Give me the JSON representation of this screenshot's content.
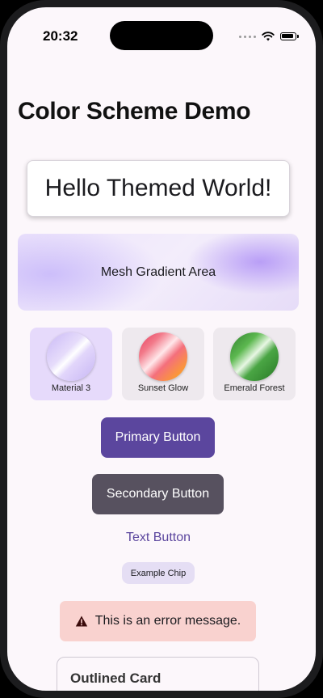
{
  "status_bar": {
    "time": "20:32"
  },
  "page": {
    "title": "Color Scheme Demo"
  },
  "hello_card": {
    "text": "Hello Themed World!"
  },
  "mesh_gradient": {
    "label": "Mesh Gradient Area"
  },
  "themes": [
    {
      "label": "Material 3",
      "selected": true
    },
    {
      "label": "Sunset Glow",
      "selected": false
    },
    {
      "label": "Emerald Forest",
      "selected": false
    }
  ],
  "buttons": {
    "primary": "Primary Button",
    "secondary": "Secondary Button",
    "text": "Text Button"
  },
  "chip": {
    "label": "Example Chip"
  },
  "error": {
    "message": "This is an error message."
  },
  "outlined_card": {
    "title": "Outlined Card"
  },
  "colors": {
    "primary": "#5b469e",
    "secondary": "#57515f",
    "error_container": "#f9d2cf",
    "background": "#fcf7fb"
  }
}
